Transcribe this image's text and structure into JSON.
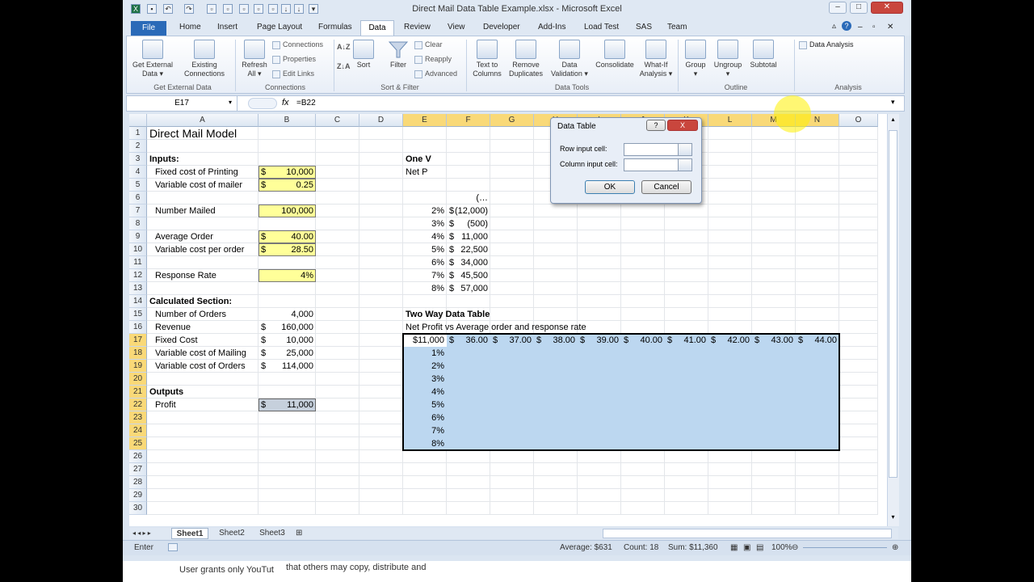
{
  "window": {
    "title": "Direct Mail Data Table Example.xlsx - Microsoft Excel"
  },
  "tabs": [
    "File",
    "Home",
    "Insert",
    "Page Layout",
    "Formulas",
    "Data",
    "Review",
    "View",
    "Developer",
    "Add-Ins",
    "Load Test",
    "SAS",
    "Team"
  ],
  "ribbon": {
    "get_external_data": "Get External\nData ▾",
    "existing_connections": "Existing\nConnections",
    "refresh_all": "Refresh\nAll ▾",
    "connections": "Connections",
    "properties": "Properties",
    "edit_links": "Edit Links",
    "sort": "Sort",
    "filter": "Filter",
    "clear": "Clear",
    "reapply": "Reapply",
    "advanced": "Advanced",
    "text_to_columns": "Text to\nColumns",
    "remove_duplicates": "Remove\nDuplicates",
    "data_validation": "Data\nValidation ▾",
    "consolidate": "Consolidate",
    "what_if": "What-If\nAnalysis ▾",
    "group": "Group\n▾",
    "ungroup": "Ungroup\n▾",
    "subtotal": "Subtotal",
    "data_analysis": "Data Analysis",
    "groups": {
      "get_external": "Get External Data",
      "connections": "Connections",
      "sort_filter": "Sort & Filter",
      "data_tools": "Data Tools",
      "outline": "Outline",
      "analysis": "Analysis"
    }
  },
  "formula_bar": {
    "name_box": "E17",
    "fx": "fx",
    "formula": "=B22"
  },
  "columns": [
    "A",
    "B",
    "C",
    "D",
    "E",
    "F",
    "G",
    "H",
    "I",
    "J",
    "K",
    "L",
    "M",
    "N",
    "O"
  ],
  "rows": [
    "1",
    "2",
    "3",
    "4",
    "5",
    "6",
    "7",
    "8",
    "9",
    "10",
    "11",
    "12",
    "13",
    "14",
    "15",
    "16",
    "17",
    "18",
    "19",
    "20",
    "21",
    "22",
    "23",
    "24",
    "25",
    "26",
    "27",
    "28",
    "29",
    "30"
  ],
  "cells": {
    "A1": "Direct Mail Model",
    "A3": "Inputs:",
    "A4": "Fixed cost of Printing",
    "B4_sym": "$",
    "B4": "10,000",
    "A5": "Variable cost of mailer",
    "B5_sym": "$",
    "B5": "0.25",
    "A7": "Number Mailed",
    "B7": "100,000",
    "A9": "Average Order",
    "B9_sym": "$",
    "B9": "40.00",
    "A10": "Variable cost per order",
    "B10_sym": "$",
    "B10": "28.50",
    "A12": "Response Rate",
    "B12": "4%",
    "A14": "Calculated Section:",
    "A15": "Number of Orders",
    "B15": "4,000",
    "A16": "Revenue",
    "B16_sym": "$",
    "B16": "160,000",
    "A17": "Fixed Cost",
    "B17_sym": "$",
    "B17": "10,000",
    "A18": "Variable cost of Mailing",
    "B18_sym": "$",
    "B18": "25,000",
    "A19": "Variable cost of Orders",
    "B19_sym": "$",
    "B19": "114,000",
    "A21": "Outputs",
    "A22": "Profit",
    "B22_sym": "$",
    "B22": "11,000",
    "E3": "One V",
    "E4": "Net P",
    "F6": "(…",
    "E15": "Two Way Data Table",
    "E16": "Net Profit vs Average order and response rate",
    "E17": "$11,000"
  },
  "one_way_table": [
    {
      "rate": "2%",
      "sym": "$",
      "value": "(12,000)"
    },
    {
      "rate": "3%",
      "sym": "$",
      "value": "(500)"
    },
    {
      "rate": "4%",
      "sym": "$",
      "value": "11,000"
    },
    {
      "rate": "5%",
      "sym": "$",
      "value": "22,500"
    },
    {
      "rate": "6%",
      "sym": "$",
      "value": "34,000"
    },
    {
      "rate": "7%",
      "sym": "$",
      "value": "45,500"
    },
    {
      "rate": "8%",
      "sym": "$",
      "value": "57,000"
    }
  ],
  "two_way_header": [
    "$",
    "36.00",
    "$",
    "37.00",
    "$",
    "38.00",
    "$",
    "39.00",
    "$",
    "40.00",
    "$",
    "41.00",
    "$",
    "42.00",
    "$",
    "43.00",
    "$",
    "44.00"
  ],
  "two_way_rates": [
    "1%",
    "2%",
    "3%",
    "4%",
    "5%",
    "6%",
    "7%",
    "8%"
  ],
  "dialog": {
    "title": "Data Table",
    "row_input_label": "Row input cell:",
    "column_input_label": "Column input cell:",
    "ok": "OK",
    "cancel": "Cancel",
    "help": "?",
    "close": "X"
  },
  "sheets": [
    "Sheet1",
    "Sheet2",
    "Sheet3"
  ],
  "status": {
    "mode": "Enter",
    "average": "Average: $631",
    "count": "Count: 18",
    "sum": "Sum: $11,360",
    "zoom": "100%"
  },
  "overlay": {
    "left": "User grants only YouTut",
    "right": "that others may copy, distribute and"
  },
  "colors": {
    "selection": "#bcd7f0",
    "input_yellow": "#ffff99",
    "header_selected": "#f9d978",
    "file_tab": "#2a6ab8"
  }
}
